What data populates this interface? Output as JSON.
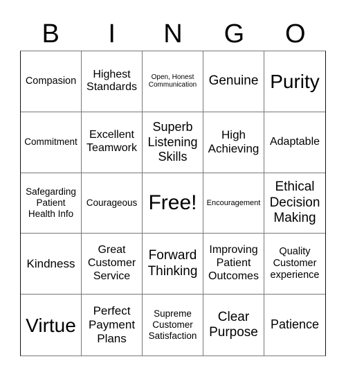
{
  "header": {
    "letters": [
      "B",
      "I",
      "N",
      "G",
      "O"
    ]
  },
  "cells": [
    {
      "text": "Compasion"
    },
    {
      "text": "Highest Standards"
    },
    {
      "text": "Open, Honest Communication"
    },
    {
      "text": "Genuine"
    },
    {
      "text": "Purity"
    },
    {
      "text": "Commitment"
    },
    {
      "text": "Excellent Teamwork"
    },
    {
      "text": "Superb Listening Skills"
    },
    {
      "text": "High Achieving"
    },
    {
      "text": "Adaptable"
    },
    {
      "text": "Safegarding Patient Health Info"
    },
    {
      "text": "Courageous"
    },
    {
      "text": "Free!"
    },
    {
      "text": "Encouragement"
    },
    {
      "text": "Ethical Decision Making"
    },
    {
      "text": "Kindness"
    },
    {
      "text": "Great Customer Service"
    },
    {
      "text": "Forward Thinking"
    },
    {
      "text": "Improving Patient Outcomes"
    },
    {
      "text": "Quality Customer experience"
    },
    {
      "text": "Virtue"
    },
    {
      "text": "Perfect Payment Plans"
    },
    {
      "text": "Supreme Customer Satisfaction"
    },
    {
      "text": "Clear Purpose"
    },
    {
      "text": "Patience"
    }
  ]
}
